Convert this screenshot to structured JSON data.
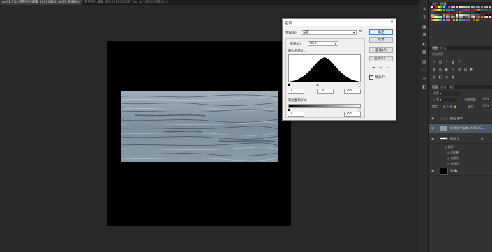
{
  "tabs": [
    {
      "label": "@ 61.3% (背景图片编辑_2021092514037, RGB/8) *",
      "close": "×"
    },
    {
      "label": "背景图片编辑_2021092514037.jpg @ 100%(RGB/8)",
      "close": "×"
    }
  ],
  "right_toolbar": {
    "buttons": [
      "A",
      "¶",
      "▣",
      "⊞",
      "◐",
      "▦",
      "▤",
      "▢",
      "☰",
      "◧"
    ]
  },
  "panels": {
    "swatch_tabs": [
      "颜色",
      "色板"
    ],
    "adjust_tabs": [
      "调整",
      "样式"
    ],
    "adjust_hint": "添加调整",
    "layer_tabs": [
      "图层",
      "通道",
      "路径"
    ],
    "layer_filter": "类型",
    "blend_mode": "正常",
    "opacity_label": "不透明度:",
    "opacity_value": "100%",
    "lock_label": "锁定:",
    "fill_label": "填充:",
    "fill_value": "100%",
    "layers": [
      {
        "name": "图层 副本",
        "type": "text"
      },
      {
        "name": "背景图片编辑_2021092...",
        "type": "image",
        "selected": true
      },
      {
        "name": "图层 1",
        "type": "fx"
      },
      {
        "name": "背景",
        "type": "bg"
      }
    ],
    "effects_label": "效果",
    "effects": [
      "内阴影",
      "内发光",
      "外发光"
    ],
    "swatch_colors": [
      "#ffffff",
      "#000000",
      "#ff0000",
      "#ffff00",
      "#00ff00",
      "#00ffff",
      "#0000ff",
      "#ff00ff",
      "#f7977a",
      "#fbad82",
      "#fdc68c",
      "#fff79a",
      "#c4df9b",
      "#a3d39c",
      "#82ca9c",
      "#7bcdc8",
      "#6ecff6",
      "#7ea7d8",
      "#8493ca",
      "#8882be",
      "#a187be",
      "#bc8dbf",
      "#f49bc1",
      "#f5989d",
      "#ed1c24",
      "#f26522",
      "#f7941d",
      "#fff200",
      "#8dc63f",
      "#39b54a",
      "#00a651",
      "#00a99d",
      "#00aeef",
      "#0072bc",
      "#0054a6",
      "#2e3192",
      "#662d91",
      "#92278f",
      "#ec008c",
      "#ed145b",
      "#9e0b0f",
      "#a0410d",
      "#a3620a",
      "#aba000",
      "#598527",
      "#197b30",
      "#007236",
      "#00746b",
      "#0076a3",
      "#004a80",
      "#003471",
      "#1b1464",
      "#440e62",
      "#630460",
      "#9e005d",
      "#9e0039",
      "#790000",
      "#7b2e00",
      "#7d4900",
      "#827b00",
      "#406618",
      "#005e20",
      "#005826",
      "#005952",
      "#005b7f",
      "#003663",
      "#002157",
      "#0d004c",
      "#32004b",
      "#4b0049",
      "#7b0046",
      "#7a0026",
      "#c7b299",
      "#998675",
      "#736357",
      "#534741",
      "#37302d",
      "#c69c6d",
      "#a67c52",
      "#8c6239",
      "#754c24",
      "#603913",
      "#ffffff",
      "#ebebeb",
      "#d7d7d7",
      "#c2c2c2",
      "#adadad",
      "#999999",
      "#858585",
      "#707070",
      "#5c5c5c",
      "#474747",
      "#333333",
      "#1f1f1f",
      "#0a0a0a",
      "#000000",
      "#ff8080",
      "#ffbf80",
      "#ffff80",
      "#80ff80",
      "#80ffff",
      "#8080ff",
      "#ff80ff",
      "#c08080",
      "#80c080",
      "#8080c0",
      "#c0c080",
      "#80c0c0",
      "#c080c0",
      "#404040",
      "#606060",
      "#909090",
      "#b0b0b0",
      "#e0e0e0",
      "#a0522d",
      "#d2691e",
      "#cd853f",
      "#deb887",
      "#f5deb3",
      "#ffe4c4",
      "#e06666",
      "#f6b26b",
      "#ffd966",
      "#93c47d",
      "#76a5af",
      "#6fa8dc",
      "#8e7cc3",
      "#c27ba0",
      "#cc0000",
      "#e69138",
      "#f1c232",
      "#6aa84f",
      "#45818e",
      "#3d85c6",
      "#674ea7",
      "#a64d79",
      "#990000",
      "#b45f06",
      "#bf9000",
      "#38761d",
      "#134f5c",
      "#0b5394",
      "#351c75",
      "#741b47"
    ]
  },
  "dialog": {
    "title": "色阶",
    "preset_label": "预设(E):",
    "preset_value": "自定",
    "channel_label": "通道(C):",
    "channel_value": "RGB",
    "input_label": "输入色阶(I):",
    "input_values": [
      "0",
      "1.41",
      "255"
    ],
    "output_label": "输出色阶(O):",
    "output_values": [
      "0",
      "255"
    ],
    "buttons": {
      "ok": "确定",
      "cancel": "取消",
      "auto": "自动(A)",
      "options": "选项(T)..."
    },
    "preview_label": "预览(P)",
    "preview_checked": true,
    "close": "×",
    "menu_icon": "⇆"
  }
}
